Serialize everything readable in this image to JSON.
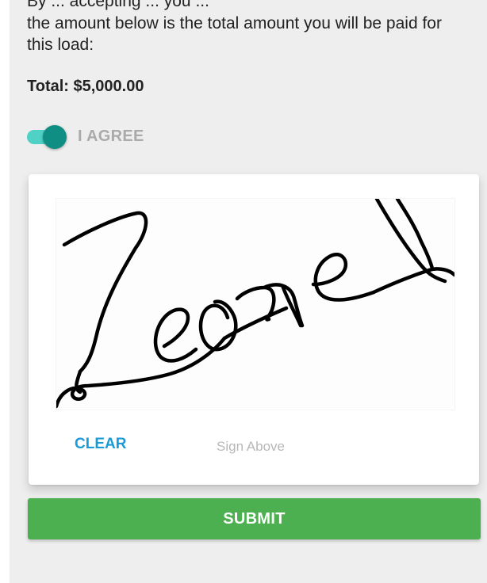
{
  "disclosure": {
    "clipped_line": "By ... accepting ... you ...",
    "text": "the amount below is the total amount you will be paid for this load:"
  },
  "total": {
    "label": "Total: $5,000.00"
  },
  "agreement": {
    "toggle_on": true,
    "label": "I AGREE",
    "track_color": "#4fd1c5",
    "thumb_color": "#0f8f83"
  },
  "signature": {
    "handwritten_text": "Leonel",
    "clear_label": "CLEAR",
    "hint": "Sign Above"
  },
  "submit": {
    "label": "SUBMIT",
    "color": "#4caf50"
  }
}
